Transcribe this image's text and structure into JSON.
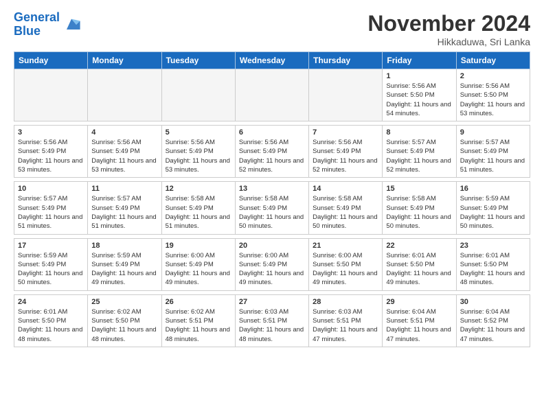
{
  "header": {
    "logo_line1": "General",
    "logo_line2": "Blue",
    "month_title": "November 2024",
    "location": "Hikkaduwa, Sri Lanka"
  },
  "days_of_week": [
    "Sunday",
    "Monday",
    "Tuesday",
    "Wednesday",
    "Thursday",
    "Friday",
    "Saturday"
  ],
  "weeks": [
    [
      {
        "day": "",
        "empty": true
      },
      {
        "day": "",
        "empty": true
      },
      {
        "day": "",
        "empty": true
      },
      {
        "day": "",
        "empty": true
      },
      {
        "day": "",
        "empty": true
      },
      {
        "day": "1",
        "sunrise": "Sunrise: 5:56 AM",
        "sunset": "Sunset: 5:50 PM",
        "daylight": "Daylight: 11 hours and 54 minutes."
      },
      {
        "day": "2",
        "sunrise": "Sunrise: 5:56 AM",
        "sunset": "Sunset: 5:50 PM",
        "daylight": "Daylight: 11 hours and 53 minutes."
      }
    ],
    [
      {
        "day": "3",
        "sunrise": "Sunrise: 5:56 AM",
        "sunset": "Sunset: 5:49 PM",
        "daylight": "Daylight: 11 hours and 53 minutes."
      },
      {
        "day": "4",
        "sunrise": "Sunrise: 5:56 AM",
        "sunset": "Sunset: 5:49 PM",
        "daylight": "Daylight: 11 hours and 53 minutes."
      },
      {
        "day": "5",
        "sunrise": "Sunrise: 5:56 AM",
        "sunset": "Sunset: 5:49 PM",
        "daylight": "Daylight: 11 hours and 53 minutes."
      },
      {
        "day": "6",
        "sunrise": "Sunrise: 5:56 AM",
        "sunset": "Sunset: 5:49 PM",
        "daylight": "Daylight: 11 hours and 52 minutes."
      },
      {
        "day": "7",
        "sunrise": "Sunrise: 5:56 AM",
        "sunset": "Sunset: 5:49 PM",
        "daylight": "Daylight: 11 hours and 52 minutes."
      },
      {
        "day": "8",
        "sunrise": "Sunrise: 5:57 AM",
        "sunset": "Sunset: 5:49 PM",
        "daylight": "Daylight: 11 hours and 52 minutes."
      },
      {
        "day": "9",
        "sunrise": "Sunrise: 5:57 AM",
        "sunset": "Sunset: 5:49 PM",
        "daylight": "Daylight: 11 hours and 51 minutes."
      }
    ],
    [
      {
        "day": "10",
        "sunrise": "Sunrise: 5:57 AM",
        "sunset": "Sunset: 5:49 PM",
        "daylight": "Daylight: 11 hours and 51 minutes."
      },
      {
        "day": "11",
        "sunrise": "Sunrise: 5:57 AM",
        "sunset": "Sunset: 5:49 PM",
        "daylight": "Daylight: 11 hours and 51 minutes."
      },
      {
        "day": "12",
        "sunrise": "Sunrise: 5:58 AM",
        "sunset": "Sunset: 5:49 PM",
        "daylight": "Daylight: 11 hours and 51 minutes."
      },
      {
        "day": "13",
        "sunrise": "Sunrise: 5:58 AM",
        "sunset": "Sunset: 5:49 PM",
        "daylight": "Daylight: 11 hours and 50 minutes."
      },
      {
        "day": "14",
        "sunrise": "Sunrise: 5:58 AM",
        "sunset": "Sunset: 5:49 PM",
        "daylight": "Daylight: 11 hours and 50 minutes."
      },
      {
        "day": "15",
        "sunrise": "Sunrise: 5:58 AM",
        "sunset": "Sunset: 5:49 PM",
        "daylight": "Daylight: 11 hours and 50 minutes."
      },
      {
        "day": "16",
        "sunrise": "Sunrise: 5:59 AM",
        "sunset": "Sunset: 5:49 PM",
        "daylight": "Daylight: 11 hours and 50 minutes."
      }
    ],
    [
      {
        "day": "17",
        "sunrise": "Sunrise: 5:59 AM",
        "sunset": "Sunset: 5:49 PM",
        "daylight": "Daylight: 11 hours and 50 minutes."
      },
      {
        "day": "18",
        "sunrise": "Sunrise: 5:59 AM",
        "sunset": "Sunset: 5:49 PM",
        "daylight": "Daylight: 11 hours and 49 minutes."
      },
      {
        "day": "19",
        "sunrise": "Sunrise: 6:00 AM",
        "sunset": "Sunset: 5:49 PM",
        "daylight": "Daylight: 11 hours and 49 minutes."
      },
      {
        "day": "20",
        "sunrise": "Sunrise: 6:00 AM",
        "sunset": "Sunset: 5:49 PM",
        "daylight": "Daylight: 11 hours and 49 minutes."
      },
      {
        "day": "21",
        "sunrise": "Sunrise: 6:00 AM",
        "sunset": "Sunset: 5:50 PM",
        "daylight": "Daylight: 11 hours and 49 minutes."
      },
      {
        "day": "22",
        "sunrise": "Sunrise: 6:01 AM",
        "sunset": "Sunset: 5:50 PM",
        "daylight": "Daylight: 11 hours and 49 minutes."
      },
      {
        "day": "23",
        "sunrise": "Sunrise: 6:01 AM",
        "sunset": "Sunset: 5:50 PM",
        "daylight": "Daylight: 11 hours and 48 minutes."
      }
    ],
    [
      {
        "day": "24",
        "sunrise": "Sunrise: 6:01 AM",
        "sunset": "Sunset: 5:50 PM",
        "daylight": "Daylight: 11 hours and 48 minutes."
      },
      {
        "day": "25",
        "sunrise": "Sunrise: 6:02 AM",
        "sunset": "Sunset: 5:50 PM",
        "daylight": "Daylight: 11 hours and 48 minutes."
      },
      {
        "day": "26",
        "sunrise": "Sunrise: 6:02 AM",
        "sunset": "Sunset: 5:51 PM",
        "daylight": "Daylight: 11 hours and 48 minutes."
      },
      {
        "day": "27",
        "sunrise": "Sunrise: 6:03 AM",
        "sunset": "Sunset: 5:51 PM",
        "daylight": "Daylight: 11 hours and 48 minutes."
      },
      {
        "day": "28",
        "sunrise": "Sunrise: 6:03 AM",
        "sunset": "Sunset: 5:51 PM",
        "daylight": "Daylight: 11 hours and 47 minutes."
      },
      {
        "day": "29",
        "sunrise": "Sunrise: 6:04 AM",
        "sunset": "Sunset: 5:51 PM",
        "daylight": "Daylight: 11 hours and 47 minutes."
      },
      {
        "day": "30",
        "sunrise": "Sunrise: 6:04 AM",
        "sunset": "Sunset: 5:52 PM",
        "daylight": "Daylight: 11 hours and 47 minutes."
      }
    ]
  ]
}
